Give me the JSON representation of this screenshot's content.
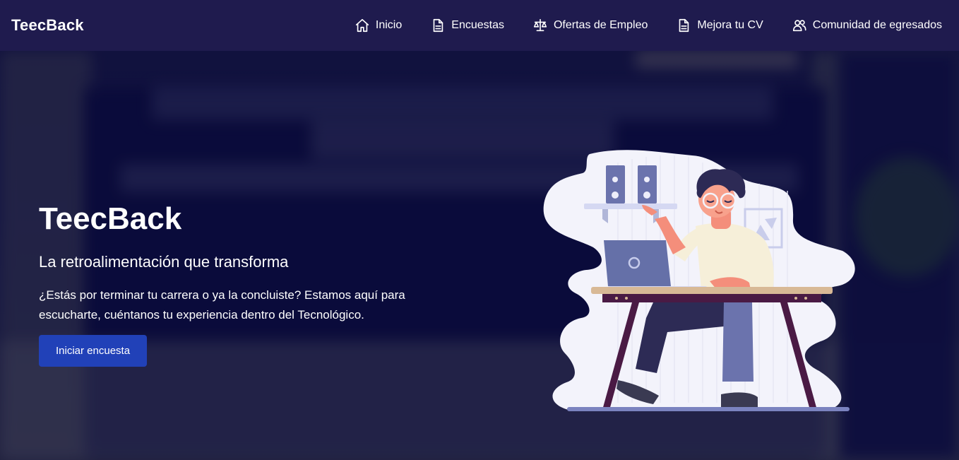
{
  "brand": "TeecBack",
  "nav": {
    "inicio": "Inicio",
    "encuestas": "Encuestas",
    "ofertas": "Ofertas de Empleo",
    "mejora_cv": "Mejora tu CV",
    "comunidad": "Comunidad de egresados"
  },
  "hero": {
    "title": "TeecBack",
    "subtitle": "La retroalimentación que transforma",
    "text": "¿Estás por terminar tu carrera o ya la concluiste? Estamos aquí para escucharte, cuéntanos tu experiencia dentro del Tecnológico.",
    "cta_label": "Iniciar encuesta"
  },
  "colors": {
    "navbar": "#1f1b4e",
    "cta": "#2141b8",
    "illustration_bg": "#f3f3fb"
  },
  "icons": {
    "inicio": "home-icon",
    "encuestas": "document-icon",
    "ofertas": "scale-icon",
    "mejora_cv": "document-icon",
    "comunidad": "users-icon"
  }
}
